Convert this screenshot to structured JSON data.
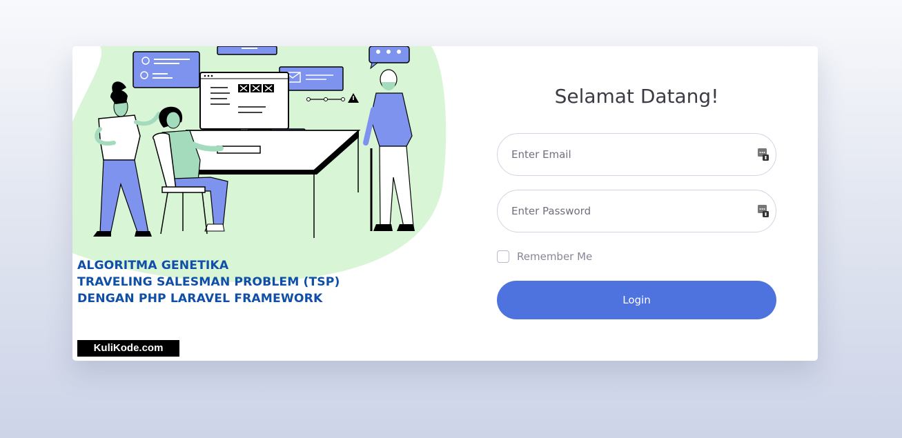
{
  "branding": {
    "headline_lines": [
      "ALGORITMA GENETIKA",
      "TRAVELING SALESMAN PROBLEM (TSP)",
      "DENGAN PHP LARAVEL FRAMEWORK"
    ],
    "watermark": "KuliKode.com"
  },
  "login": {
    "title": "Selamat Datang!",
    "email_placeholder": "Enter Email",
    "email_value": "",
    "password_placeholder": "Enter Password",
    "password_value": "",
    "remember_label": "Remember Me",
    "remember_checked": false,
    "button_label": "Login"
  },
  "icons": {
    "password_manager": "password-manager-key-icon",
    "warning": "warning-icon",
    "email": "envelope-icon",
    "chat": "chat-bubble-icon"
  },
  "colors": {
    "accent": "#4e73df",
    "headline": "#0f4fa8",
    "blob": "#d8f5d6",
    "illustration_blue": "#7d93ee",
    "illustration_green": "#a3dbbc"
  }
}
